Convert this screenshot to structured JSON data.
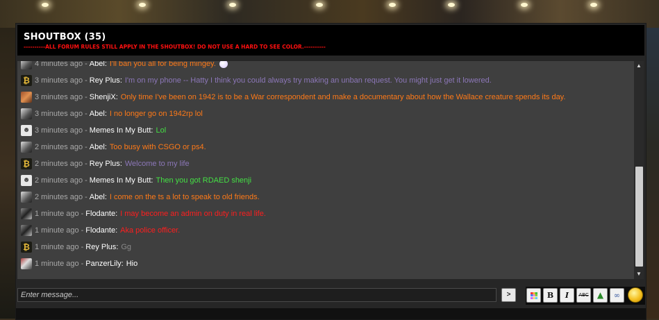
{
  "shoutbox": {
    "title": "SHOUTBOX (35)",
    "rules": "----------ALL FORUM RULES STILL APPLY IN THE SHOUTBOX! DO NOT USE A HARD TO SEE COLOR.----------"
  },
  "messages": [
    {
      "time": "4 minutes ago",
      "user": "Abel",
      "text": "I'll ban you all for being mingey.",
      "color": "#ff7a18",
      "avatar": "abel-avatar"
    },
    {
      "time": "3 minutes ago",
      "user": "Rey Plus",
      "text": "I'm on my phone -- Hatty I think you could always try making an unban request. You might just get it lowered.",
      "color": "#8c77b8",
      "avatar": "rey-avatar"
    },
    {
      "time": "3 minutes ago",
      "user": "ShenjiX",
      "text": "Only time I've been on 1942 is to be a War correspondent and make a documentary about how the Wallace creature spends its day.",
      "color": "#ff7a18",
      "avatar": "shenji-avatar"
    },
    {
      "time": "3 minutes ago",
      "user": "Abel",
      "text": "I no longer go on 1942rp lol",
      "color": "#ff7a18",
      "avatar": "abel-avatar"
    },
    {
      "time": "3 minutes ago",
      "user": "Memes In My Butt",
      "text": "Lol",
      "color": "#44e044",
      "avatar": "memes-avatar"
    },
    {
      "time": "2 minutes ago",
      "user": "Abel",
      "text": "Too busy with CSGO or ps4.",
      "color": "#ff7a18",
      "avatar": "abel-avatar"
    },
    {
      "time": "2 minutes ago",
      "user": "Rey Plus",
      "text": "Welcome to my life",
      "color": "#8c77b8",
      "avatar": "rey-avatar"
    },
    {
      "time": "2 minutes ago",
      "user": "Memes In My Butt",
      "text": "Then you got RDAED shenji",
      "color": "#44e044",
      "avatar": "memes-avatar"
    },
    {
      "time": "2 minutes ago",
      "user": "Abel",
      "text": "I come on the ts a lot to speak to old friends.",
      "color": "#ff7a18",
      "avatar": "abel-avatar"
    },
    {
      "time": "1 minute ago",
      "user": "Flodante",
      "text": "I may become an admin on duty in real life.",
      "color": "#ff1e1e",
      "avatar": "flodante-avatar"
    },
    {
      "time": "1 minute ago",
      "user": "Flodante",
      "text": "Aka police officer.",
      "color": "#ff1e1e",
      "avatar": "flodante-avatar"
    },
    {
      "time": "1 minute ago",
      "user": "Rey Plus",
      "text": "Gg",
      "color": "#8a8a8a",
      "avatar": "rey-avatar"
    },
    {
      "time": "1 minute ago",
      "user": "PanzerLily",
      "text": "Hio",
      "color": "#ffffff",
      "avatar": "panzer-avatar"
    }
  ],
  "separator": "-",
  "input": {
    "placeholder": "Enter message...",
    "send_label": ">"
  },
  "toolbar": {
    "bold_label": "B",
    "italic_label": "I",
    "strike_label": "ABC",
    "icons": [
      "color-grid-icon",
      "bold-icon",
      "italic-icon",
      "strikethrough-icon",
      "image-icon",
      "link-icon",
      "smiley-icon"
    ]
  },
  "scrollbar": {
    "up": "▲",
    "down": "▼"
  }
}
